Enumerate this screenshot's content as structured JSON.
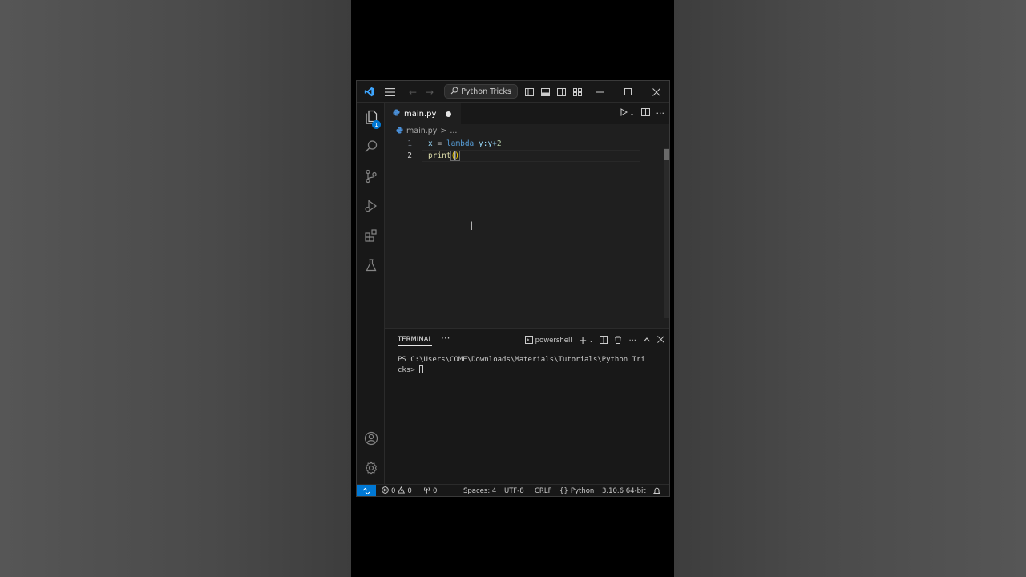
{
  "titlebar": {
    "search_label": "Python Tricks"
  },
  "activity": {
    "explorer_badge": "1"
  },
  "tab": {
    "filename": "main.py"
  },
  "breadcrumb": {
    "file": "main.py",
    "separator": ">",
    "more": "..."
  },
  "editor": {
    "lines": [
      {
        "number": "1"
      },
      {
        "number": "2"
      }
    ],
    "line1": {
      "var": "x",
      "eq": "=",
      "kw": "lambda",
      "rest": "y:y+",
      "num": "2"
    },
    "line2": {
      "fn": "print",
      "open": "(",
      "close": ")"
    }
  },
  "panel": {
    "title": "TERMINAL",
    "more": "···",
    "shell": "powershell"
  },
  "terminal": {
    "line1": "PS C:\\Users\\COME\\Downloads\\Materials\\Tutorials\\Python Tri",
    "line2": "cks> "
  },
  "status": {
    "errors": "0",
    "warnings": "0",
    "ports": "0",
    "spaces": "Spaces: 4",
    "encoding": "UTF-8",
    "eol": "CRLF",
    "language": "Python",
    "interpreter": "3.10.6 64-bit"
  },
  "colors": {
    "accent": "#0078d4",
    "keyword": "#569cd6",
    "variable": "#9cdcfe",
    "function": "#dcdcaa",
    "bracket": "#ffd700"
  }
}
